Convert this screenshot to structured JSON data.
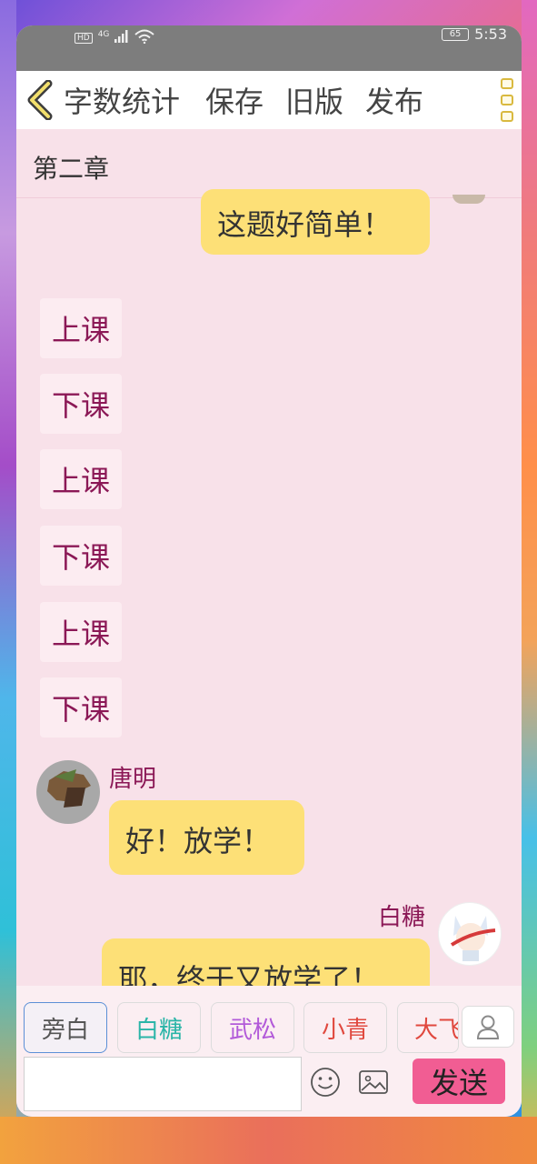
{
  "status_bar": {
    "network_hd": "HD",
    "network_type": "4G",
    "battery": "65",
    "time": "5:53"
  },
  "toolbar": {
    "items": [
      "字数统计",
      "保存",
      "旧版",
      "发布"
    ]
  },
  "chapter": {
    "title": "第二章"
  },
  "chat": {
    "top_message": "这题好简单！",
    "chips": [
      "上课",
      "下课",
      "上课",
      "下课",
      "上课",
      "下课"
    ],
    "tangming": {
      "name": "唐明",
      "message": "好！放学！"
    },
    "baitang": {
      "name": "白糖",
      "message": "耶，终于又放学了！"
    }
  },
  "input": {
    "characters": [
      {
        "label": "旁白",
        "color": "#555555"
      },
      {
        "label": "白糖",
        "color": "#2bb5a8"
      },
      {
        "label": "武松",
        "color": "#b25ad9"
      },
      {
        "label": "小青",
        "color": "#e0483e"
      },
      {
        "label": "大飞",
        "color": "#e0483e"
      }
    ],
    "send_label": "发送",
    "text_value": ""
  }
}
